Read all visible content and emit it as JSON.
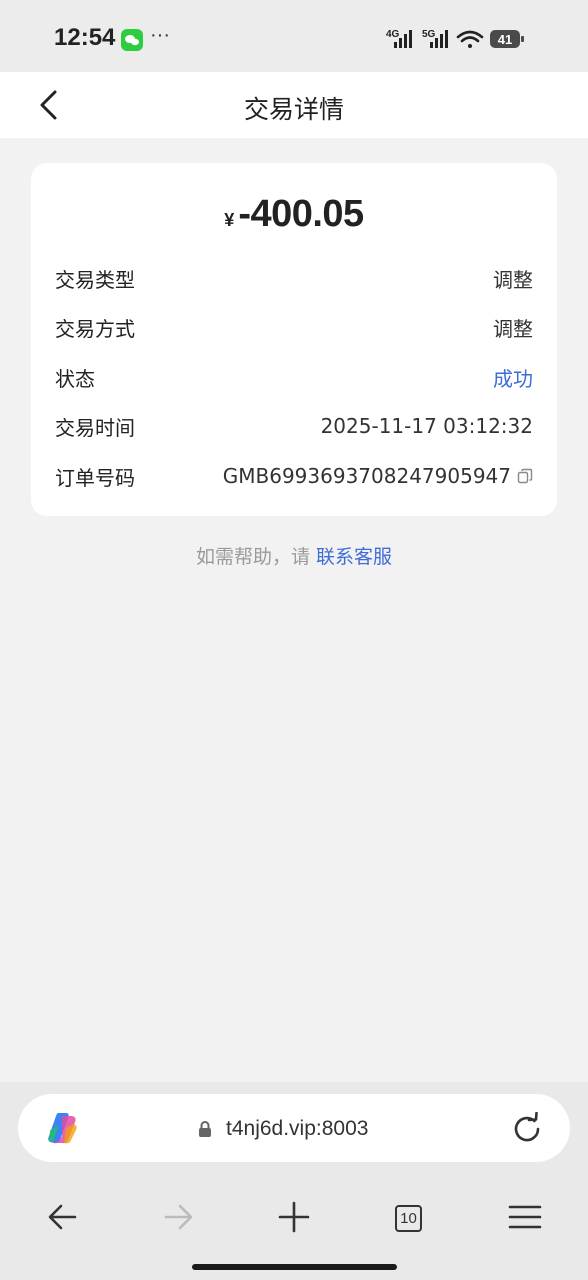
{
  "status_bar": {
    "time": "12:54",
    "more": "···",
    "signal_1_label": "4G",
    "signal_2_label": "5G",
    "battery": "41"
  },
  "header": {
    "title": "交易详情"
  },
  "transaction": {
    "currency_symbol": "¥",
    "amount": "-400.05",
    "rows": [
      {
        "label": "交易类型",
        "value": "调整"
      },
      {
        "label": "交易方式",
        "value": "调整"
      },
      {
        "label": "状态",
        "value": "成功"
      },
      {
        "label": "交易时间",
        "value": "2025-11-17 03:12:32"
      },
      {
        "label": "订单号码",
        "value": "GMB6993693708247905947"
      }
    ]
  },
  "help": {
    "prefix": "如需帮助，请 ",
    "link": "联系客服"
  },
  "browser": {
    "url": "t4nj6d.vip:8003",
    "tab_count": "10"
  },
  "colors": {
    "accent": "#3f6cd6",
    "background": "#f2f2f3",
    "card": "#ffffff"
  }
}
